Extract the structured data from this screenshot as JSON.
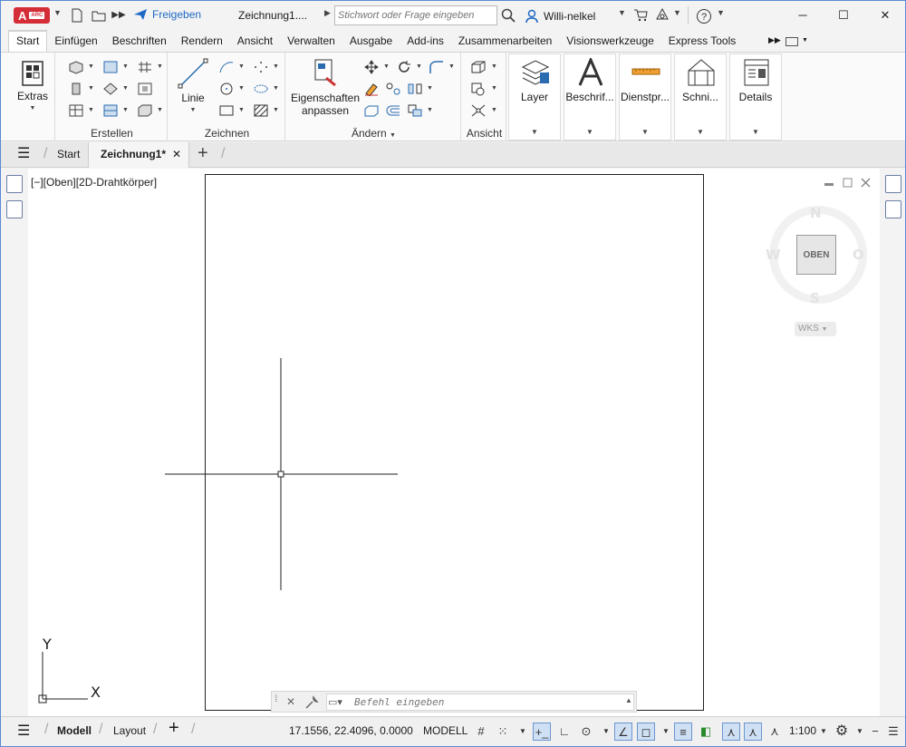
{
  "titlebar": {
    "logo": "A",
    "logo_sub": "ARC",
    "share": "Freigeben",
    "doc_title": "Zeichnung1....",
    "search_placeholder": "Stichwort oder Frage eingeben",
    "user": "Willi-nelkel"
  },
  "tabs": [
    "Start",
    "Einfügen",
    "Beschriften",
    "Rendern",
    "Ansicht",
    "Verwalten",
    "Ausgabe",
    "Add-ins",
    "Zusammenarbeiten",
    "Visionswerkzeuge",
    "Express Tools"
  ],
  "active_tab": "Start",
  "ribbon": {
    "extras": "Extras",
    "erstellen": "Erstellen",
    "linie": "Linie",
    "zeichnen": "Zeichnen",
    "eigenschaften_1": "Eigenschaften",
    "eigenschaften_2": "anpassen",
    "aendern": "Ändern",
    "ansicht": "Ansicht",
    "layer": "Layer",
    "beschrif": "Beschrif...",
    "dienstpr": "Dienstpr...",
    "schni": "Schni...",
    "details": "Details"
  },
  "filetabs": {
    "start": "Start",
    "drawing": "Zeichnung1*"
  },
  "viewport": {
    "label": "[−][Oben][2D-Drahtkörper]"
  },
  "viewcube": {
    "n": "N",
    "s": "S",
    "w": "W",
    "o": "O",
    "face": "OBEN",
    "ucs": "WKS"
  },
  "ucs_icon": {
    "x": "X",
    "y": "Y"
  },
  "command": {
    "placeholder": "Befehl eingeben"
  },
  "status": {
    "modell_tab": "Modell",
    "layout_tab": "Layout",
    "coords": "17.1556, 22.4096, 0.0000",
    "modell": "MODELL",
    "scale": "1:100"
  },
  "colors": {
    "accent": "#1f68c4",
    "logo": "#d42d38",
    "toggle_on": "#cfe0f5"
  }
}
